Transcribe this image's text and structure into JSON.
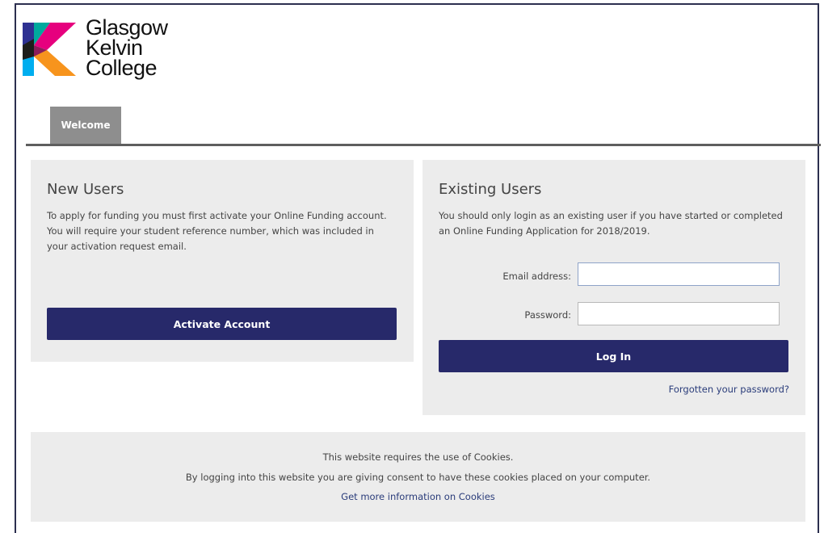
{
  "brand": {
    "line1": "Glasgow",
    "line2": "Kelvin",
    "line3": "College",
    "colors": [
      "#e6007e",
      "#f7941d",
      "#00a99d",
      "#1d1d1b",
      "#2e3192"
    ]
  },
  "nav": {
    "tab_welcome": "Welcome"
  },
  "new_users": {
    "title": "New Users",
    "text": "To apply for funding you must first activate your Online Funding account. You will require your student reference number, which was included in your activation request email.",
    "button": "Activate Account"
  },
  "existing_users": {
    "title": "Existing Users",
    "text": "You should only login as an existing user if you have started or completed an Online Funding Application for 2018/2019.",
    "email_label": "Email address:",
    "email_value": "",
    "password_label": "Password:",
    "password_value": "",
    "login_button": "Log In",
    "forgot_link": "Forgotten your password?"
  },
  "cookies": {
    "line1": "This website requires the use of Cookies.",
    "line2": "By logging into this website you are giving consent to have these cookies placed on your computer.",
    "link": "Get more information on Cookies"
  },
  "theme": {
    "button_color": "#27296a",
    "panel_color": "#ececec",
    "link_color": "#2a3c7a"
  }
}
